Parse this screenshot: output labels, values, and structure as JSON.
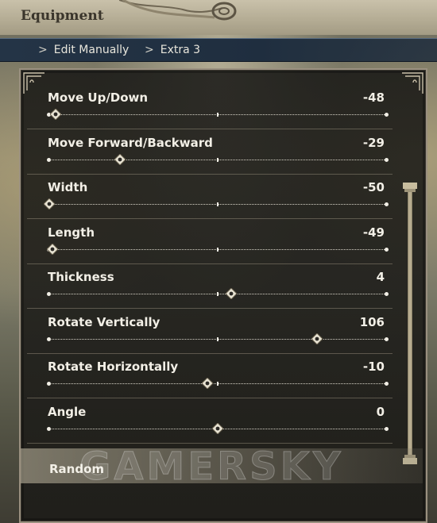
{
  "header": {
    "title": "Equipment"
  },
  "breadcrumb": [
    {
      "sep": ">",
      "label": "Edit Manually"
    },
    {
      "sep": ">",
      "label": "Extra 3"
    }
  ],
  "sliders": [
    {
      "label": "Move Up/Down",
      "value": "-48",
      "level": 0.02
    },
    {
      "label": "Move Forward/Backward",
      "value": "-29",
      "level": 0.21
    },
    {
      "label": "Width",
      "value": "-50",
      "level": 0.0
    },
    {
      "label": "Length",
      "value": "-49",
      "level": 0.01
    },
    {
      "label": "Thickness",
      "value": "4",
      "level": 0.54
    },
    {
      "label": "Rotate Vertically",
      "value": "106",
      "level": 0.795
    },
    {
      "label": "Rotate Horizontally",
      "value": "-10",
      "level": 0.47
    },
    {
      "label": "Angle",
      "value": "0",
      "level": 0.5
    }
  ],
  "random_label": "Random",
  "watermark": "GAMERSKY",
  "colors": {
    "panel": "#1a1916",
    "text": "#f2efe6",
    "crumb_bar": "#243446"
  }
}
